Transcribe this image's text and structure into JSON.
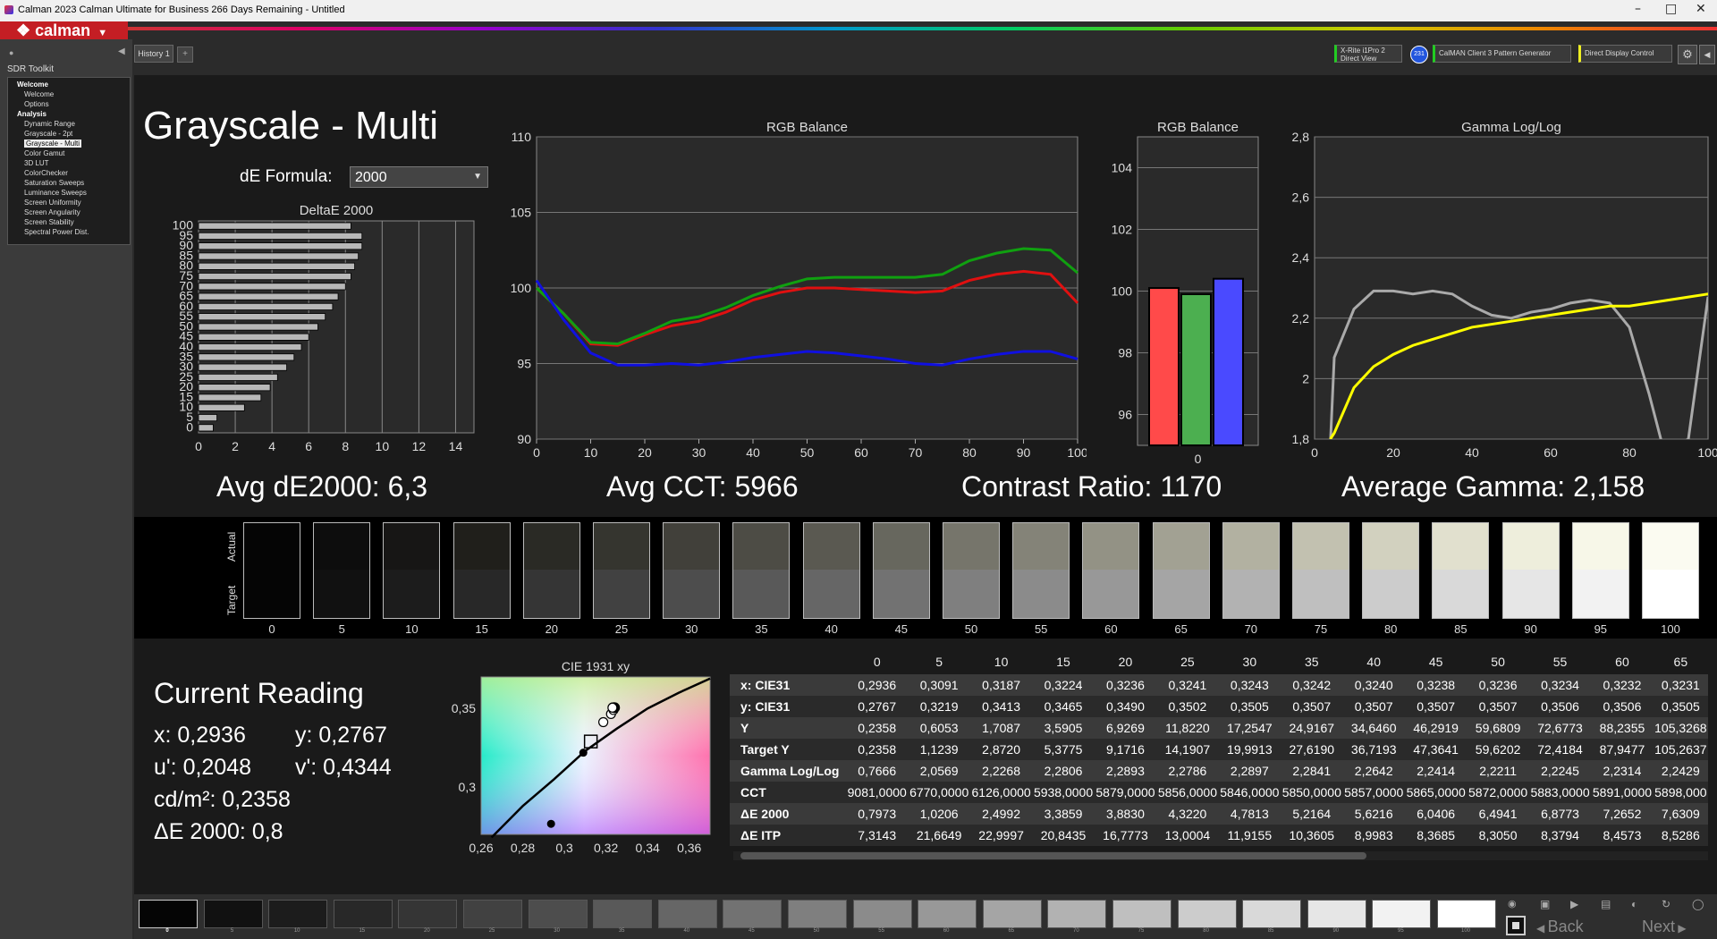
{
  "window": {
    "title": "Calman 2023 Calman Ultimate for Business 266 Days Remaining  - Untitled",
    "brand": "calman",
    "controls": {
      "minimize": "–",
      "maximize": "□",
      "close": "✕"
    }
  },
  "sidebar": {
    "title": "SDR Toolkit",
    "items": [
      {
        "label": "Welcome",
        "level": 0
      },
      {
        "label": "Welcome",
        "level": 1
      },
      {
        "label": "Options",
        "level": 1
      },
      {
        "label": "Analysis",
        "level": 0
      },
      {
        "label": "Dynamic Range",
        "level": 1
      },
      {
        "label": "Grayscale - 2pt",
        "level": 1
      },
      {
        "label": "Grayscale - Multi",
        "level": 1,
        "selected": true
      },
      {
        "label": "Color Gamut",
        "level": 1
      },
      {
        "label": "3D LUT",
        "level": 1
      },
      {
        "label": "ColorChecker",
        "level": 1
      },
      {
        "label": "Saturation Sweeps",
        "level": 1
      },
      {
        "label": "Luminance Sweeps",
        "level": 1
      },
      {
        "label": "Screen Uniformity",
        "level": 1
      },
      {
        "label": "Screen Angularity",
        "level": 1
      },
      {
        "label": "Screen Stability",
        "level": 1
      },
      {
        "label": "Spectral Power Dist.",
        "level": 1
      }
    ]
  },
  "tabs": {
    "history": "History 1"
  },
  "devices": {
    "meter_line1": "X-Rite i1Pro 2",
    "meter_line2": "Direct View",
    "meter_badge": "231",
    "pattern": "CalMAN Client 3 Pattern Generator",
    "display": "Direct Display Control"
  },
  "page": {
    "title": "Grayscale - Multi",
    "de_formula_label": "dE Formula:",
    "de_formula_value": "2000"
  },
  "stats": {
    "avg_de": "Avg dE2000: 6,3",
    "avg_cct": "Avg CCT: 5966",
    "contrast": "Contrast Ratio: 1170",
    "gamma": "Average Gamma: 2,158"
  },
  "chart_data": [
    {
      "type": "bar",
      "title": "DeltaE 2000",
      "orientation": "horizontal",
      "categories": [
        "0",
        "5",
        "10",
        "15",
        "20",
        "25",
        "30",
        "35",
        "40",
        "45",
        "50",
        "55",
        "60",
        "65",
        "70",
        "75",
        "80",
        "85",
        "90",
        "95",
        "100"
      ],
      "values": [
        0.8,
        1.0,
        2.5,
        3.4,
        3.9,
        4.3,
        4.8,
        5.2,
        5.6,
        6.0,
        6.5,
        6.9,
        7.3,
        7.6,
        8.0,
        8.3,
        8.5,
        8.7,
        8.9,
        8.9,
        8.3
      ],
      "xticks": [
        "0",
        "2",
        "4",
        "6",
        "8",
        "10",
        "12",
        "14"
      ],
      "yticks": [
        "0",
        "5",
        "10",
        "15",
        "20",
        "25",
        "30",
        "35",
        "40",
        "45",
        "50",
        "55",
        "60",
        "65",
        "70",
        "75",
        "80",
        "85",
        "90",
        "95",
        "100"
      ],
      "xlim": [
        0,
        15
      ]
    },
    {
      "type": "line",
      "title": "RGB Balance",
      "x": [
        0,
        5,
        10,
        15,
        20,
        25,
        30,
        35,
        40,
        45,
        50,
        55,
        60,
        65,
        70,
        75,
        80,
        85,
        90,
        95,
        100
      ],
      "series": [
        {
          "color": "#e01010",
          "values": [
            100,
            98.3,
            96.3,
            96.2,
            96.9,
            97.5,
            97.8,
            98.4,
            99.2,
            99.7,
            100.0,
            100.0,
            99.9,
            99.8,
            99.7,
            99.8,
            100.5,
            100.9,
            101.1,
            100.9,
            99.0
          ]
        },
        {
          "color": "#10a010",
          "values": [
            100,
            98.3,
            96.4,
            96.3,
            97.0,
            97.8,
            98.1,
            98.7,
            99.5,
            100.1,
            100.6,
            100.7,
            100.7,
            100.7,
            100.7,
            100.9,
            101.8,
            102.3,
            102.6,
            102.5,
            101.0
          ]
        },
        {
          "color": "#1010e0",
          "values": [
            100.5,
            97.9,
            95.7,
            94.9,
            94.9,
            95.0,
            94.9,
            95.1,
            95.4,
            95.6,
            95.8,
            95.7,
            95.5,
            95.3,
            95.0,
            94.9,
            95.3,
            95.6,
            95.8,
            95.8,
            95.3
          ]
        }
      ],
      "xticks": [
        "0",
        "10",
        "20",
        "30",
        "40",
        "50",
        "60",
        "70",
        "80",
        "90",
        "100"
      ],
      "yticks": [
        "90",
        "95",
        "100",
        "105",
        "110"
      ],
      "xlim": [
        0,
        100
      ],
      "ylim": [
        90,
        110
      ]
    },
    {
      "type": "bar",
      "title": "RGB Balance",
      "categories": [
        "0"
      ],
      "series": [
        {
          "color": "#ff4a4a",
          "values": [
            100.1
          ]
        },
        {
          "color": "#4caf50",
          "values": [
            99.9
          ]
        },
        {
          "color": "#4a4aff",
          "values": [
            100.4
          ]
        }
      ],
      "yticks": [
        "96",
        "98",
        "100",
        "102",
        "104"
      ],
      "ylim": [
        95,
        105
      ]
    },
    {
      "type": "line",
      "title": "Gamma Log/Log",
      "x": [
        0,
        5,
        10,
        15,
        20,
        25,
        30,
        35,
        40,
        45,
        50,
        55,
        60,
        65,
        70,
        75,
        80,
        85,
        90,
        95,
        100
      ],
      "series": [
        {
          "color": "#aaaaaa",
          "values": [
            null,
            2.07,
            2.23,
            2.29,
            2.29,
            2.28,
            2.29,
            2.28,
            2.24,
            2.21,
            2.2,
            2.22,
            2.23,
            2.25,
            2.26,
            2.25,
            2.17,
            1.95,
            1.7,
            1.8,
            2.27
          ]
        },
        {
          "color": "#ffff00",
          "values": [
            null,
            1.82,
            1.97,
            2.04,
            2.08,
            2.11,
            2.13,
            2.15,
            2.17,
            2.18,
            2.19,
            2.2,
            2.21,
            2.22,
            2.23,
            2.24,
            2.24,
            2.25,
            2.26,
            2.27,
            2.28
          ]
        }
      ],
      "xticks": [
        "0",
        "20",
        "40",
        "60",
        "80",
        "100"
      ],
      "yticks": [
        "1,8",
        "2",
        "2,2",
        "2,4",
        "2,6",
        "2,8"
      ],
      "xlim": [
        0,
        100
      ],
      "ylim": [
        1.8,
        2.8
      ]
    },
    {
      "type": "scatter",
      "title": "CIE 1931 xy",
      "xticks": [
        "0,26",
        "0,28",
        "0,3",
        "0,32",
        "0,34",
        "0,36"
      ],
      "yticks": [
        "0,3",
        "0,35"
      ],
      "xlim": [
        0.26,
        0.37
      ],
      "ylim": [
        0.27,
        0.37
      ],
      "points": [
        {
          "x": 0.2936,
          "y": 0.2767,
          "kind": "current"
        },
        {
          "x": 0.3091,
          "y": 0.3219
        },
        {
          "x": 0.3187,
          "y": 0.3413
        },
        {
          "x": 0.3224,
          "y": 0.3465
        },
        {
          "x": 0.3236,
          "y": 0.349
        },
        {
          "x": 0.3241,
          "y": 0.3502
        },
        {
          "x": 0.3243,
          "y": 0.3505
        },
        {
          "x": 0.3242,
          "y": 0.3507
        },
        {
          "x": 0.324,
          "y": 0.3507
        },
        {
          "x": 0.3238,
          "y": 0.3507
        },
        {
          "x": 0.3236,
          "y": 0.3507
        },
        {
          "x": 0.3234,
          "y": 0.3506
        },
        {
          "x": 0.3232,
          "y": 0.3506
        },
        {
          "x": 0.3231,
          "y": 0.3505
        }
      ],
      "target": {
        "x": 0.3127,
        "y": 0.329
      }
    }
  ],
  "swatches": {
    "actual_label": "Actual",
    "target_label": "Target",
    "items": [
      {
        "label": "0",
        "actual": "#050505",
        "target": "#050505"
      },
      {
        "label": "5",
        "actual": "#0d0d0d",
        "target": "#111111"
      },
      {
        "label": "10",
        "actual": "#171615",
        "target": "#1c1c1c"
      },
      {
        "label": "15",
        "actual": "#201f1b",
        "target": "#282828"
      },
      {
        "label": "20",
        "actual": "#2a2a25",
        "target": "#353535"
      },
      {
        "label": "25",
        "actual": "#35352f",
        "target": "#414141"
      },
      {
        "label": "30",
        "actual": "#41403a",
        "target": "#4d4d4d"
      },
      {
        "label": "35",
        "actual": "#4d4c45",
        "target": "#595959"
      },
      {
        "label": "40",
        "actual": "#5a5951",
        "target": "#666666"
      },
      {
        "label": "45",
        "actual": "#67675e",
        "target": "#727272"
      },
      {
        "label": "50",
        "actual": "#76756b",
        "target": "#7f7f7f"
      },
      {
        "label": "55",
        "actual": "#848378",
        "target": "#8b8b8b"
      },
      {
        "label": "60",
        "actual": "#939285",
        "target": "#989898"
      },
      {
        "label": "65",
        "actual": "#a2a193",
        "target": "#a5a5a5"
      },
      {
        "label": "70",
        "actual": "#b2b1a1",
        "target": "#b2b2b2"
      },
      {
        "label": "75",
        "actual": "#c2c1b0",
        "target": "#bfbfbf"
      },
      {
        "label": "80",
        "actual": "#d2d1bf",
        "target": "#cccccc"
      },
      {
        "label": "85",
        "actual": "#e1e0ce",
        "target": "#d9d9d9"
      },
      {
        "label": "90",
        "actual": "#eeeedc",
        "target": "#e6e6e6"
      },
      {
        "label": "95",
        "actual": "#f7f7e8",
        "target": "#f2f2f2"
      },
      {
        "label": "100",
        "actual": "#fbfbf1",
        "target": "#ffffff"
      }
    ]
  },
  "reading": {
    "title": "Current Reading",
    "x": "x: 0,2936",
    "y": "y: 0,2767",
    "u": "u': 0,2048",
    "v": "v': 0,4344",
    "cd": "cd/m²: 0,2358",
    "de": "ΔE 2000: 0,8"
  },
  "table": {
    "columns": [
      "0",
      "5",
      "10",
      "15",
      "20",
      "25",
      "30",
      "35",
      "40",
      "45",
      "50",
      "55",
      "60",
      "65"
    ],
    "rows": [
      {
        "label": "x: CIE31",
        "values": [
          "0,2936",
          "0,3091",
          "0,3187",
          "0,3224",
          "0,3236",
          "0,3241",
          "0,3243",
          "0,3242",
          "0,3240",
          "0,3238",
          "0,3236",
          "0,3234",
          "0,3232",
          "0,3231"
        ]
      },
      {
        "label": "y: CIE31",
        "values": [
          "0,2767",
          "0,3219",
          "0,3413",
          "0,3465",
          "0,3490",
          "0,3502",
          "0,3505",
          "0,3507",
          "0,3507",
          "0,3507",
          "0,3507",
          "0,3506",
          "0,3506",
          "0,3505"
        ]
      },
      {
        "label": "Y",
        "values": [
          "0,2358",
          "0,6053",
          "1,7087",
          "3,5905",
          "6,9269",
          "11,8220",
          "17,2547",
          "24,9167",
          "34,6460",
          "46,2919",
          "59,6809",
          "72,6773",
          "88,2355",
          "105,3268"
        ]
      },
      {
        "label": "Target Y",
        "values": [
          "0,2358",
          "1,1239",
          "2,8720",
          "5,3775",
          "9,1716",
          "14,1907",
          "19,9913",
          "27,6190",
          "36,7193",
          "47,3641",
          "59,6202",
          "72,4184",
          "87,9477",
          "105,2637"
        ]
      },
      {
        "label": "Gamma Log/Log",
        "values": [
          "0,7666",
          "2,0569",
          "2,2268",
          "2,2806",
          "2,2893",
          "2,2786",
          "2,2897",
          "2,2841",
          "2,2642",
          "2,2414",
          "2,2211",
          "2,2245",
          "2,2314",
          "2,2429"
        ]
      },
      {
        "label": "CCT",
        "values": [
          "9081,0000",
          "6770,0000",
          "6126,0000",
          "5938,0000",
          "5879,0000",
          "5856,0000",
          "5846,0000",
          "5850,0000",
          "5857,0000",
          "5865,0000",
          "5872,0000",
          "5883,0000",
          "5891,0000",
          "5898,000"
        ]
      },
      {
        "label": "ΔE 2000",
        "values": [
          "0,7973",
          "1,0206",
          "2,4992",
          "3,3859",
          "3,8830",
          "4,3220",
          "4,7813",
          "5,2164",
          "5,6216",
          "6,0406",
          "6,4941",
          "6,8773",
          "7,2652",
          "7,6309"
        ]
      },
      {
        "label": "ΔE ITP",
        "values": [
          "7,3143",
          "21,6649",
          "22,9997",
          "20,8435",
          "16,7773",
          "13,0004",
          "11,9155",
          "10,3605",
          "8,9983",
          "8,3685",
          "8,3050",
          "8,3794",
          "8,4573",
          "8,5286"
        ]
      }
    ]
  },
  "bottom": {
    "swatch_labels": [
      "0",
      "5",
      "10",
      "15",
      "20",
      "25",
      "30",
      "35",
      "40",
      "45",
      "50",
      "55",
      "60",
      "65",
      "70",
      "75",
      "80",
      "85",
      "90",
      "95",
      "100"
    ],
    "swatch_colors": [
      "#050505",
      "#111111",
      "#1c1c1c",
      "#282828",
      "#353535",
      "#414141",
      "#4d4d4d",
      "#595959",
      "#666666",
      "#727272",
      "#7f7f7f",
      "#8b8b8b",
      "#989898",
      "#a5a5a5",
      "#b2b2b2",
      "#bfbfbf",
      "#cccccc",
      "#d9d9d9",
      "#e6e6e6",
      "#f2f2f2",
      "#ffffff"
    ],
    "back": "Back",
    "next": "Next"
  }
}
